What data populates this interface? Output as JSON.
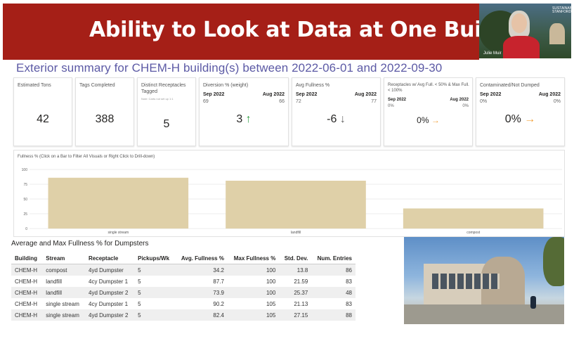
{
  "banner": {
    "title": "Ability to Look at Data at One Building"
  },
  "webcam": {
    "participant_name": "Julie Muir",
    "badge_text": "SUSTAINABLE STANFORD"
  },
  "subtitle": "Exterior summary for CHEM-H building(s) between 2022-06-01 and 2022-09-30",
  "cards": {
    "estimated_tons": {
      "title": "Estimated Tons",
      "value": "42"
    },
    "tags_completed": {
      "title": "Tags Completed",
      "value": "388"
    },
    "distinct_receptacles": {
      "title": "Distinct Receptacles Tagged",
      "note": "Note: Carts not set up 1:1",
      "value": "5"
    },
    "diversion": {
      "title": "Diversion % (weight)",
      "left_label": "Sep 2022",
      "right_label": "Aug 2022",
      "left_value": "69",
      "right_value": "66",
      "value": "3",
      "arrow": "↑"
    },
    "avg_fullness": {
      "title": "Avg Fullness %",
      "left_label": "Sep 2022",
      "right_label": "Aug 2022",
      "left_value": "72",
      "right_value": "77",
      "value": "-6",
      "arrow": "↓"
    },
    "receptacles_low": {
      "title": "Receptacles w/ Avg Full. < 50% & Max Full. < 100%",
      "left_label": "Sep 2022",
      "right_label": "Aug 2022",
      "left_value": "0%",
      "right_value": "0%",
      "value": "0%",
      "arrow": "→"
    },
    "contaminated": {
      "title": "Contaminated/Not Dumped",
      "left_label": "Sep 2022",
      "right_label": "Aug 2022",
      "left_value": "0%",
      "right_value": "0%",
      "value": "0%",
      "arrow": "→"
    }
  },
  "chart_data": {
    "type": "bar",
    "title": "Fullness % (Click on a Bar to Filter All Visuals or Right Click to Drill-down)",
    "categories": [
      "single stream",
      "landfill",
      "compost"
    ],
    "values": [
      86,
      81,
      34
    ],
    "ylim": [
      0,
      100
    ],
    "yticks": [
      0,
      25,
      50,
      75,
      100
    ],
    "bar_color": "#dfd0a8",
    "xlabel": "",
    "ylabel": ""
  },
  "table": {
    "title": "Average and Max Fullness % for Dumpsters",
    "columns": [
      "Building",
      "Stream",
      "Receptacle",
      "Pickups/Wk",
      "Avg. Fullness %",
      "Max Fullness %",
      "Std. Dev.",
      "Num. Entries"
    ],
    "rows": [
      [
        "CHEM-H",
        "compost",
        "4yd Dumpster",
        "5",
        "34.2",
        "100",
        "13.8",
        "86"
      ],
      [
        "CHEM-H",
        "landfill",
        "4cy Dumpster 1",
        "5",
        "87.7",
        "100",
        "21.59",
        "83"
      ],
      [
        "CHEM-H",
        "landfill",
        "4yd Dumpster 2",
        "5",
        "73.9",
        "100",
        "25.37",
        "48"
      ],
      [
        "CHEM-H",
        "single stream",
        "4cy Dumpster 1",
        "5",
        "90.2",
        "105",
        "21.13",
        "83"
      ],
      [
        "CHEM-H",
        "single stream",
        "4yd Dumpster 2",
        "5",
        "82.4",
        "105",
        "27.15",
        "88"
      ]
    ]
  },
  "colors": {
    "banner": "#a51f17",
    "subtitle": "#5c5aa5",
    "arrow_up": "#2f9e44",
    "arrow_side": "#f2a23c"
  }
}
